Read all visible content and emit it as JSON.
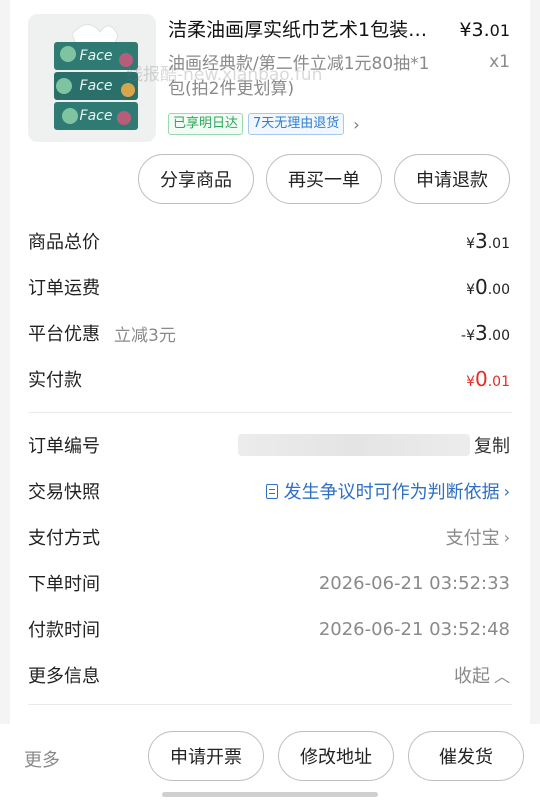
{
  "product": {
    "image_alt": "Face tissue product image",
    "brand_text": "Face",
    "title": "洁柔油画厚实纸巾艺术1包装…",
    "price_symbol": "¥",
    "price_main": "3.",
    "price_cents": "01",
    "variant": "油画经典款/第二件立减1元80抽*1包(拍2件更划算)",
    "quantity": "x1",
    "tags": [
      "已享明日达",
      "7天无理由退货"
    ]
  },
  "watermark": "线报酷-new.xianbao.fun",
  "order_actions": [
    "分享商品",
    "再买一单",
    "申请退款"
  ],
  "summary": [
    {
      "label": "商品总价",
      "sublabel": "",
      "symbol": "¥",
      "int": "3",
      "dec": ".01",
      "red": false
    },
    {
      "label": "订单运费",
      "sublabel": "",
      "symbol": "¥",
      "int": "0",
      "dec": ".00",
      "red": false
    },
    {
      "label": "平台优惠",
      "sublabel": "立减3元",
      "symbol": "-¥",
      "int": "3",
      "dec": ".00",
      "red": false
    },
    {
      "label": "实付款",
      "sublabel": "",
      "symbol": "¥",
      "int": "0",
      "dec": ".01",
      "red": true
    }
  ],
  "details": {
    "order_no_label": "订单编号",
    "copy_label": "复制",
    "snapshot_label": "交易快照",
    "snapshot_value": "发生争议时可作为判断依据",
    "payment_label": "支付方式",
    "payment_value": "支付宝",
    "order_time_label": "下单时间",
    "order_time_value": "2026-06-21 03:52:33",
    "pay_time_label": "付款时间",
    "pay_time_value": "2026-06-21 03:52:48",
    "more_info_label": "更多信息",
    "collapse_label": "收起"
  },
  "bottom_bar": {
    "more_label": "更多",
    "actions": [
      "申请开票",
      "修改地址",
      "催发货"
    ]
  },
  "colors": {
    "accent_red": "#e02e24",
    "link_blue": "#2f6fc7",
    "tag_green": "#2ea85a"
  }
}
